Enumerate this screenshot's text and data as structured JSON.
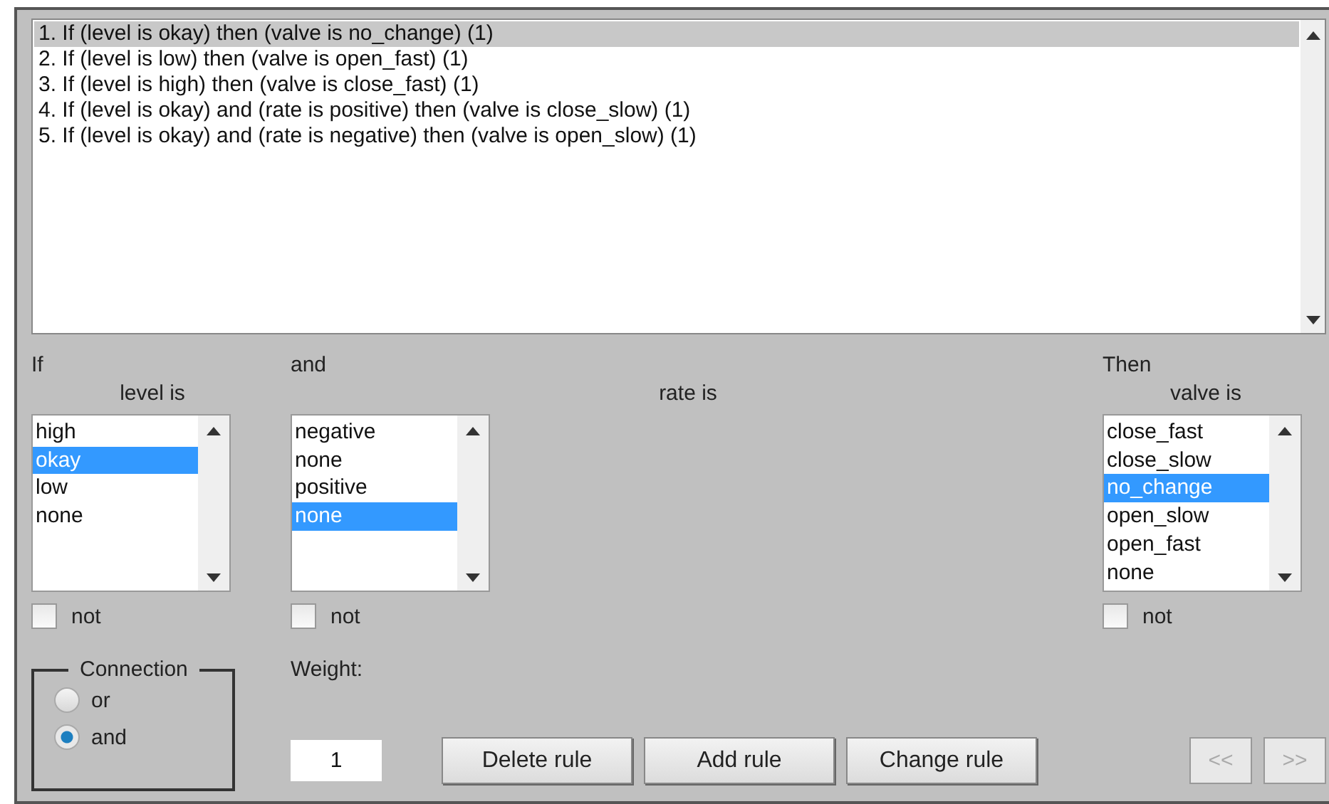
{
  "rules": [
    {
      "text": "1. If (level is okay) then (valve is no_change) (1)",
      "selected": true
    },
    {
      "text": "2. If (level is low) then (valve is open_fast) (1)",
      "selected": false
    },
    {
      "text": "3. If (level is high) then (valve is close_fast) (1)",
      "selected": false
    },
    {
      "text": "4. If (level is okay) and (rate is positive) then (valve is close_slow) (1)",
      "selected": false
    },
    {
      "text": "5. If (level is okay) and (rate is negative) then (valve is open_slow) (1)",
      "selected": false
    }
  ],
  "columns": [
    {
      "header": "If",
      "label": "level is",
      "items": [
        {
          "text": "high",
          "selected": false
        },
        {
          "text": "okay",
          "selected": true
        },
        {
          "text": "low",
          "selected": false
        },
        {
          "text": "none",
          "selected": false
        }
      ],
      "not": {
        "label": "not",
        "checked": false
      }
    },
    {
      "header": "and",
      "label": "rate is",
      "items": [
        {
          "text": "negative",
          "selected": false
        },
        {
          "text": "none",
          "selected": false
        },
        {
          "text": "positive",
          "selected": false
        },
        {
          "text": "none",
          "selected": true
        }
      ],
      "not": {
        "label": "not",
        "checked": false
      }
    },
    {
      "header": "Then",
      "label": "valve is",
      "items": [
        {
          "text": "close_fast",
          "selected": false
        },
        {
          "text": "close_slow",
          "selected": false
        },
        {
          "text": "no_change",
          "selected": true
        },
        {
          "text": "open_slow",
          "selected": false
        },
        {
          "text": "open_fast",
          "selected": false
        },
        {
          "text": "none",
          "selected": false
        }
      ],
      "not": {
        "label": "not",
        "checked": false
      }
    }
  ],
  "connection": {
    "title": "Connection",
    "options": [
      {
        "label": "or",
        "selected": false
      },
      {
        "label": "and",
        "selected": true
      }
    ]
  },
  "weight": {
    "label": "Weight:",
    "value": "1"
  },
  "buttons": [
    {
      "label": "Delete rule"
    },
    {
      "label": "Add rule"
    },
    {
      "label": "Change rule"
    }
  ],
  "nav": [
    {
      "label": "<<",
      "disabled": true
    },
    {
      "label": ">>",
      "disabled": true
    }
  ]
}
